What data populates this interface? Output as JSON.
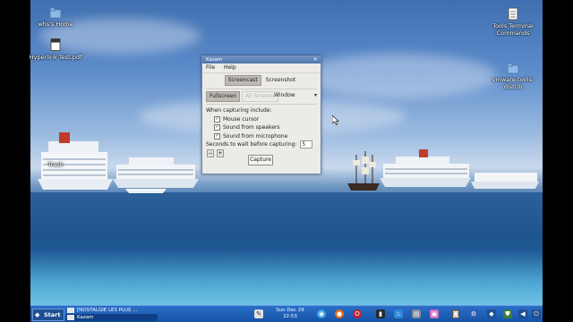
{
  "desktop": {
    "icons": [
      {
        "id": "home",
        "label": "whs's Home"
      },
      {
        "id": "pdf",
        "label": "Hyperlink Test.pdf"
      },
      {
        "id": "trash",
        "label": "Trash"
      },
      {
        "id": "terminal",
        "label": "Tools Terminal Commands"
      },
      {
        "id": "vmware",
        "label": "vmware-tools-distrib"
      }
    ]
  },
  "window": {
    "title": "Kazam",
    "menu": [
      "File",
      "Help"
    ],
    "tabs": [
      {
        "label": "Screencast",
        "active": true
      },
      {
        "label": "Screenshot",
        "active": false
      }
    ],
    "modes": [
      {
        "label": "Fullscreen",
        "state": "selected"
      },
      {
        "label": "All Screens",
        "state": "disabled"
      }
    ],
    "window_select": {
      "label": "Window",
      "arrow": "▾"
    },
    "capture_heading": "When capturing include:",
    "options": [
      {
        "label": "Mouse cursor",
        "checked": true
      },
      {
        "label": "Sound from speakers",
        "checked": true
      },
      {
        "label": "Sound from microphone",
        "checked": true
      }
    ],
    "delay_label": "Seconds to wait before capturing:",
    "delay_value": "5",
    "spin_minus": "−",
    "spin_plus": "+",
    "capture_button": "Capture"
  },
  "taskbar": {
    "start_label": "Start",
    "tasks": [
      "[NOSTALGIE LES PLUS ...",
      "Kazam"
    ],
    "clock": {
      "date": "Sun Dec 29",
      "time": "22:53"
    }
  },
  "colors": {
    "taskbar": "#1553a6",
    "titlebar": "#4f76ad",
    "window_bg": "#ecebe8"
  }
}
